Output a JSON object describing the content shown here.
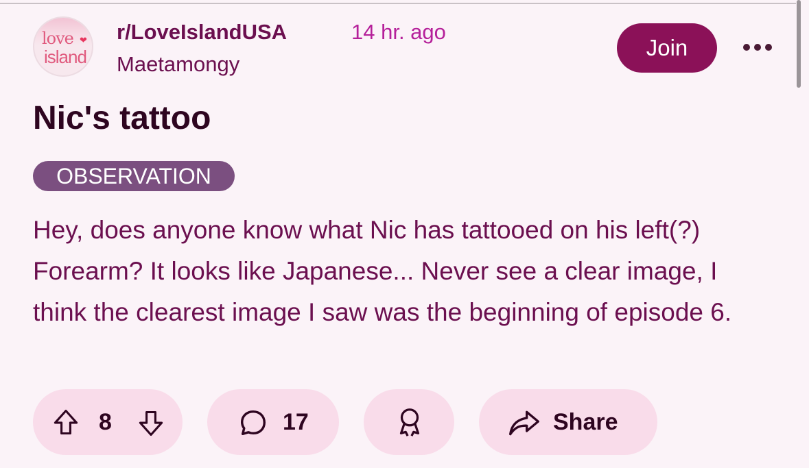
{
  "post": {
    "subreddit": "r/LoveIslandUSA",
    "time_ago": "14 hr. ago",
    "author": "Maetamongy",
    "join_label": "Join",
    "title": "Nic's tattoo",
    "flair": "OBSERVATION",
    "body": "Hey, does anyone know what Nic has tattooed on his left(?) Forearm? It looks like Japanese... Never see a clear image, I think the clearest image I saw was the beginning of episode 6."
  },
  "avatar": {
    "line1": "love",
    "line2": "island"
  },
  "actions": {
    "vote_count": "8",
    "comment_count": "17",
    "share_label": "Share"
  },
  "icons": [
    "more-icon",
    "upvote-icon",
    "downvote-icon",
    "comment-icon",
    "award-icon",
    "share-icon"
  ],
  "colors": {
    "background": "#fbf3f8",
    "accent": "#8b1158",
    "text": "#6b0f4f",
    "time": "#b5209a",
    "flair": "#7b4f80",
    "action_pill": "#f9dcea"
  }
}
